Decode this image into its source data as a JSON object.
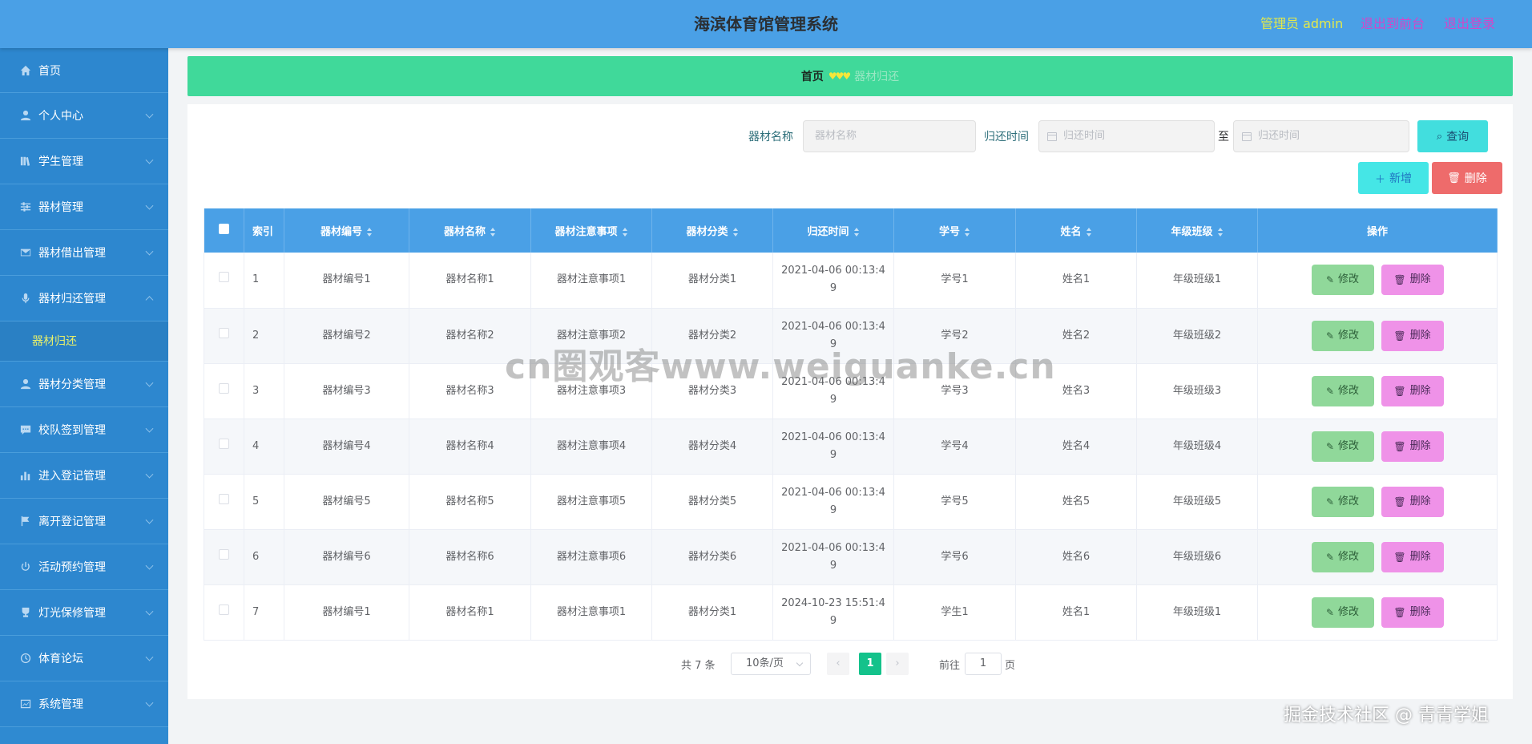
{
  "header": {
    "title": "海滨体育馆管理系统",
    "admin": "管理员 admin",
    "to_front": "退出到前台",
    "logout": "退出登录"
  },
  "sidebar": {
    "items": [
      {
        "label": "首页",
        "icon": "home-icon",
        "has_arrow": false
      },
      {
        "label": "个人中心",
        "icon": "user-icon",
        "has_arrow": true
      },
      {
        "label": "学生管理",
        "icon": "books-icon",
        "has_arrow": true
      },
      {
        "label": "器材管理",
        "icon": "sliders-icon",
        "has_arrow": true
      },
      {
        "label": "器材借出管理",
        "icon": "mail-icon",
        "has_arrow": true
      },
      {
        "label": "器材归还管理",
        "icon": "mic-icon",
        "has_arrow": true,
        "expanded": true
      },
      {
        "label": "器材分类管理",
        "icon": "user-icon",
        "has_arrow": true
      },
      {
        "label": "校队签到管理",
        "icon": "chat-icon",
        "has_arrow": true
      },
      {
        "label": "进入登记管理",
        "icon": "bar-chart-icon",
        "has_arrow": true
      },
      {
        "label": "离开登记管理",
        "icon": "flag-icon",
        "has_arrow": true
      },
      {
        "label": "活动预约管理",
        "icon": "power-icon",
        "has_arrow": true
      },
      {
        "label": "灯光保修管理",
        "icon": "trophy-icon",
        "has_arrow": true
      },
      {
        "label": "体育论坛",
        "icon": "clock-icon",
        "has_arrow": true
      },
      {
        "label": "系统管理",
        "icon": "chart-icon",
        "has_arrow": true
      }
    ],
    "submenu": {
      "label": "器材归还"
    }
  },
  "breadcrumb": {
    "home": "首页",
    "separator": "♥♥♥",
    "current": "器材归还"
  },
  "search": {
    "name_label": "器材名称",
    "name_placeholder": "器材名称",
    "time_label": "归还时间",
    "start_placeholder": "归还时间",
    "to": "至",
    "end_placeholder": "归还时间",
    "query_label": "查询"
  },
  "actions": {
    "add_label": "新增",
    "delete_label": "删除"
  },
  "table": {
    "headers": {
      "index": "索引",
      "code": "器材编号",
      "name": "器材名称",
      "notes": "器材注意事项",
      "category": "器材分类",
      "return_time": "归还时间",
      "student_no": "学号",
      "student_name": "姓名",
      "grade_class": "年级班级",
      "ops": "操作"
    },
    "edit_label": "修改",
    "delete_label": "删除",
    "rows": [
      {
        "index": "1",
        "code": "器材编号1",
        "name": "器材名称1",
        "notes": "器材注意事项1",
        "category": "器材分类1",
        "time_a": "2021-04-06 00:13:4",
        "time_b": "9",
        "student_no": "学号1",
        "student_name": "姓名1",
        "grade_class": "年级班级1"
      },
      {
        "index": "2",
        "code": "器材编号2",
        "name": "器材名称2",
        "notes": "器材注意事项2",
        "category": "器材分类2",
        "time_a": "2021-04-06 00:13:4",
        "time_b": "9",
        "student_no": "学号2",
        "student_name": "姓名2",
        "grade_class": "年级班级2"
      },
      {
        "index": "3",
        "code": "器材编号3",
        "name": "器材名称3",
        "notes": "器材注意事项3",
        "category": "器材分类3",
        "time_a": "2021-04-06 00:13:4",
        "time_b": "9",
        "student_no": "学号3",
        "student_name": "姓名3",
        "grade_class": "年级班级3"
      },
      {
        "index": "4",
        "code": "器材编号4",
        "name": "器材名称4",
        "notes": "器材注意事项4",
        "category": "器材分类4",
        "time_a": "2021-04-06 00:13:4",
        "time_b": "9",
        "student_no": "学号4",
        "student_name": "姓名4",
        "grade_class": "年级班级4"
      },
      {
        "index": "5",
        "code": "器材编号5",
        "name": "器材名称5",
        "notes": "器材注意事项5",
        "category": "器材分类5",
        "time_a": "2021-04-06 00:13:4",
        "time_b": "9",
        "student_no": "学号5",
        "student_name": "姓名5",
        "grade_class": "年级班级5"
      },
      {
        "index": "6",
        "code": "器材编号6",
        "name": "器材名称6",
        "notes": "器材注意事项6",
        "category": "器材分类6",
        "time_a": "2021-04-06 00:13:4",
        "time_b": "9",
        "student_no": "学号6",
        "student_name": "姓名6",
        "grade_class": "年级班级6"
      },
      {
        "index": "7",
        "code": "器材编号1",
        "name": "器材名称1",
        "notes": "器材注意事项1",
        "category": "器材分类1",
        "time_a": "2024-10-23 15:51:4",
        "time_b": "9",
        "student_no": "学生1",
        "student_name": "姓名1",
        "grade_class": "年级班级1"
      }
    ]
  },
  "pagination": {
    "total": "共 7 条",
    "page_size": "10条/页",
    "current": "1",
    "goto_label": "前往",
    "goto_value": "1",
    "page_unit": "页",
    "prev": "‹",
    "next": "›"
  },
  "overlay": {
    "watermark": "cn圈观客www.weiguanke.cn",
    "credit": "掘金技术社区 @ 青青学姐"
  },
  "colors": {
    "header_bg": "#4aa0e6",
    "sidebar_bg": "#2f8ad1",
    "breadcrumb_bg": "#40d99a",
    "table_header_bg": "#4aa0e6",
    "edit_button": "#90d89a",
    "delete_button": "#ef92e8",
    "pager_active": "#14c28b"
  }
}
